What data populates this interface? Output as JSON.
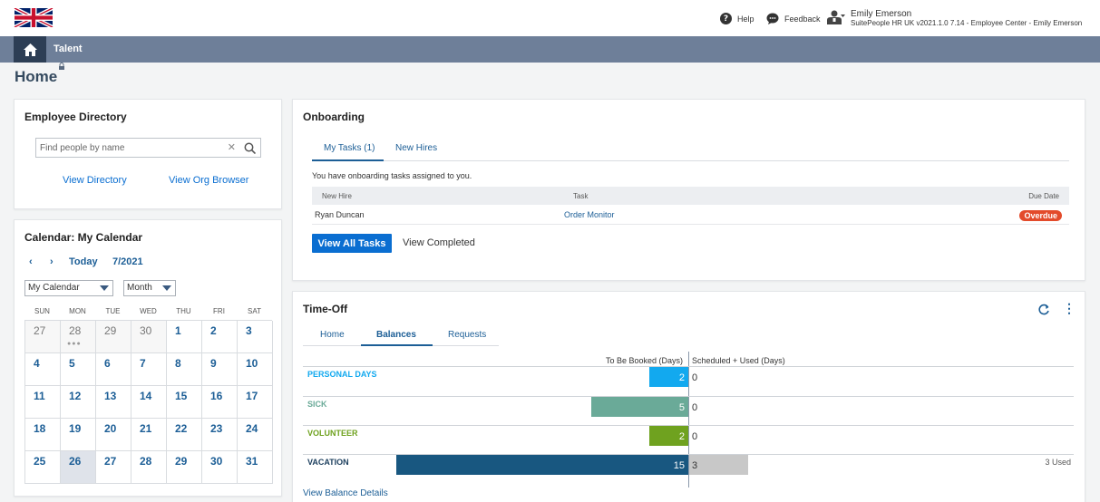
{
  "header": {
    "help_label": "Help",
    "feedback_label": "Feedback",
    "user_name": "Emily Emerson",
    "user_sub": "SuitePeople HR UK v2021.1.0 7.14 - Employee Center - Emily Emerson"
  },
  "nav": {
    "talent_label": "Talent"
  },
  "page": {
    "title": "Home"
  },
  "directory": {
    "title": "Employee Directory",
    "search_placeholder": "Find people by name",
    "view_directory": "View Directory",
    "view_org_browser": "View Org Browser"
  },
  "calendar": {
    "title": "Calendar: My Calendar",
    "today_label": "Today",
    "month_label": "7/2021",
    "calendar_select": "My Calendar",
    "view_select": "Month",
    "weekdays": [
      "SUN",
      "MON",
      "TUE",
      "WED",
      "THU",
      "FRI",
      "SAT"
    ],
    "days": [
      "27",
      "28",
      "29",
      "30",
      "1",
      "2",
      "3",
      "4",
      "5",
      "6",
      "7",
      "8",
      "9",
      "10",
      "11",
      "12",
      "13",
      "14",
      "15",
      "16",
      "17",
      "18",
      "19",
      "20",
      "21",
      "22",
      "23",
      "24",
      "25",
      "26",
      "27",
      "28",
      "29",
      "30",
      "31"
    ],
    "dots": "●●●"
  },
  "onboarding": {
    "title": "Onboarding",
    "tab_my_tasks": "My Tasks (1)",
    "tab_new_hires": "New Hires",
    "message": "You have onboarding tasks assigned to you.",
    "col_new_hire": "New Hire",
    "col_task": "Task",
    "col_due_date": "Due Date",
    "row_new_hire": "Ryan Duncan",
    "row_task": "Order Monitor",
    "row_status": "Overdue",
    "view_all_tasks": "View All Tasks",
    "view_completed": "View Completed"
  },
  "timeoff": {
    "title": "Time-Off",
    "tab_home": "Home",
    "tab_balances": "Balances",
    "tab_requests": "Requests",
    "col_to_be_booked": "To Be Booked (Days)",
    "col_scheduled_used": "Scheduled + Used (Days)",
    "view_balance_details": "View Balance Details",
    "balances": [
      {
        "label": "PERSONAL DAYS",
        "to_be_booked": "2",
        "scheduled_used": "0",
        "color": "#12a9ef"
      },
      {
        "label": "SICK",
        "to_be_booked": "5",
        "scheduled_used": "0",
        "color": "#6aaa98"
      },
      {
        "label": "VOLUNTEER",
        "to_be_booked": "2",
        "scheduled_used": "0",
        "color": "#6fa21f"
      },
      {
        "label": "VACATION",
        "to_be_booked": "15",
        "scheduled_used": "3",
        "used_text": "3 Used",
        "color": "#185780"
      }
    ]
  },
  "colors": {
    "nav_bar": "#6e7f99",
    "home_button": "#2d3e55",
    "primary": "#0a6ed1",
    "link": "#1c5e96",
    "overdue": "#e34b2b",
    "used_bar": "#c8c8c8"
  }
}
